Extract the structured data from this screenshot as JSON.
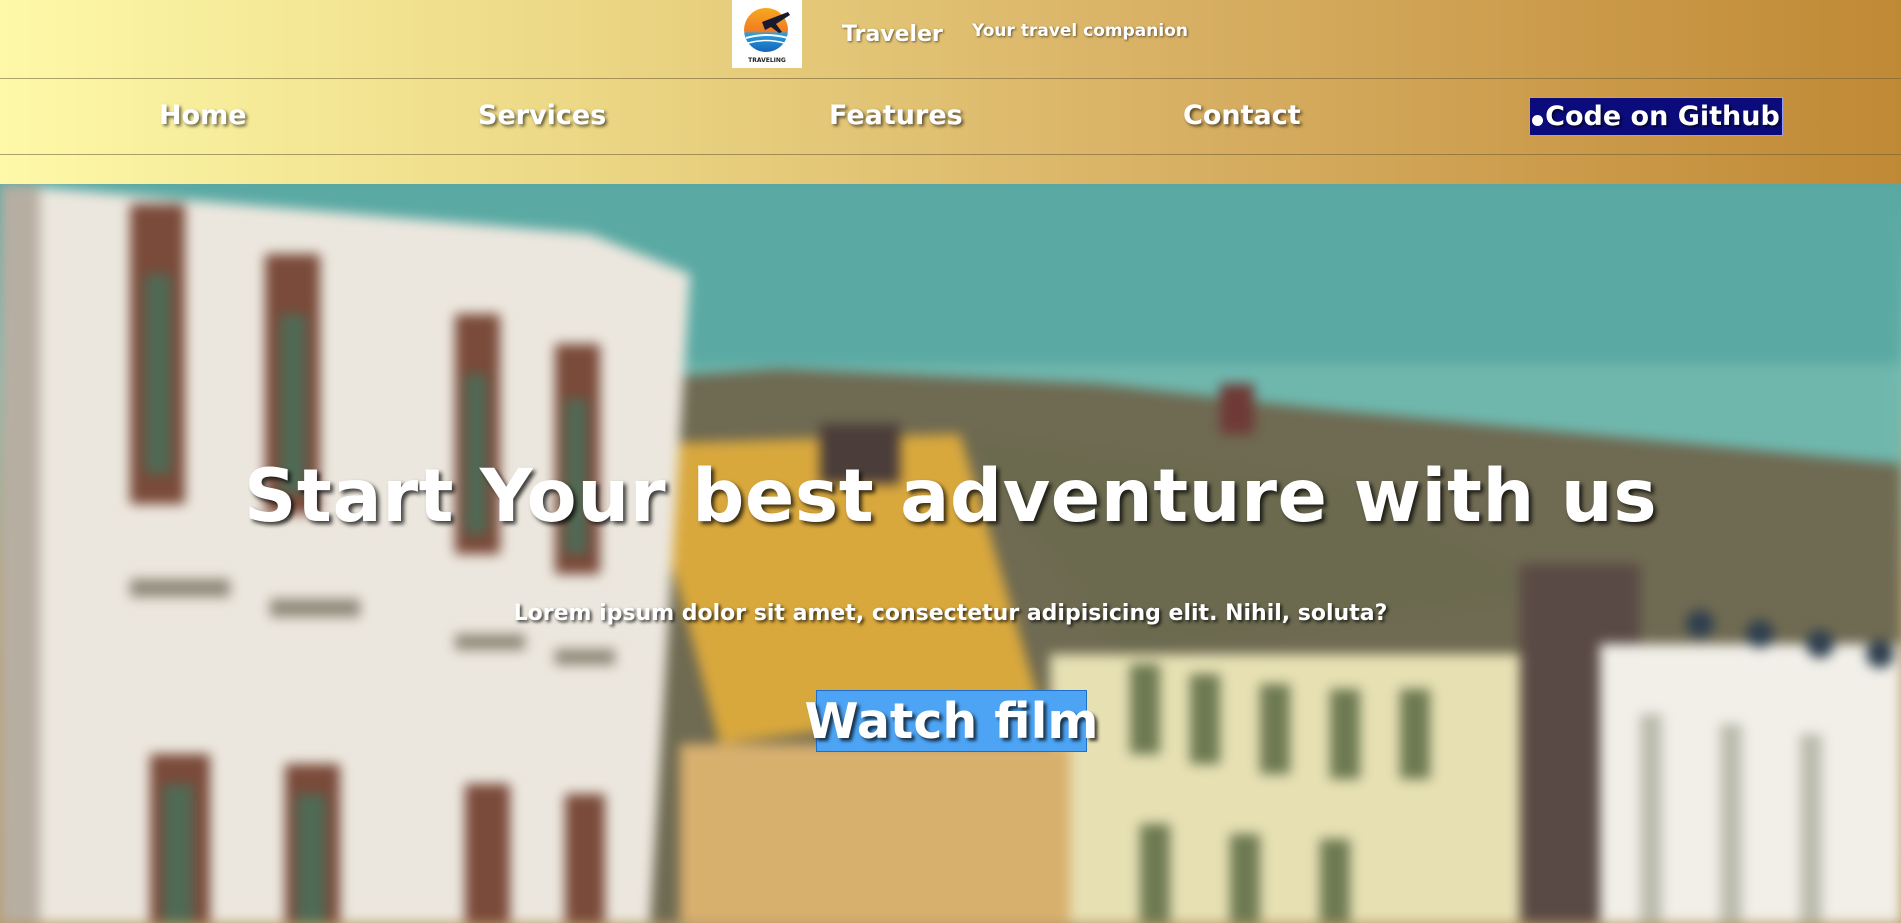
{
  "brand": {
    "logo_text": "TRAVELING",
    "name": "Traveler",
    "tagline": "Your travel companion"
  },
  "nav": {
    "items": [
      {
        "label": "Home"
      },
      {
        "label": "Services"
      },
      {
        "label": "Features"
      },
      {
        "label": "Contact"
      }
    ],
    "github": {
      "label": "Code on Github",
      "icon": "github-icon"
    }
  },
  "hero": {
    "title": "Start Your best adventure with us",
    "subtitle": "Lorem ipsum dolor sit amet, consectetur adipisicing elit. Nihil, soluta?",
    "cta_label": "Watch film"
  },
  "colors": {
    "header_gradient_start": "#fdf9a8",
    "header_gradient_end": "#c08935",
    "github_button": "#0b0b7c",
    "cta_button": "#4da4f4",
    "sky": "#57a7a2"
  }
}
